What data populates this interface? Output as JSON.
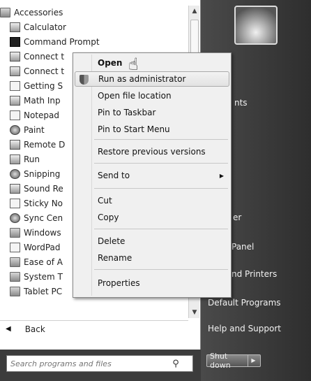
{
  "programs": [
    {
      "label": "Accessories",
      "icon": "folder-icon"
    },
    {
      "label": "Calculator",
      "icon": "calculator-icon"
    },
    {
      "label": "Command Prompt",
      "icon": "command-prompt-icon"
    },
    {
      "label": "Connect t",
      "icon": "connect-icon"
    },
    {
      "label": "Connect t",
      "icon": "connect-projector-icon"
    },
    {
      "label": "Getting S",
      "icon": "getting-started-icon"
    },
    {
      "label": "Math Inp",
      "icon": "math-input-icon"
    },
    {
      "label": "Notepad",
      "icon": "notepad-icon"
    },
    {
      "label": "Paint",
      "icon": "paint-icon"
    },
    {
      "label": "Remote D",
      "icon": "remote-desktop-icon"
    },
    {
      "label": "Run",
      "icon": "run-icon"
    },
    {
      "label": "Snipping",
      "icon": "snipping-tool-icon"
    },
    {
      "label": "Sound Re",
      "icon": "sound-recorder-icon"
    },
    {
      "label": "Sticky No",
      "icon": "sticky-notes-icon"
    },
    {
      "label": "Sync Cen",
      "icon": "sync-center-icon"
    },
    {
      "label": "Windows",
      "icon": "windows-explorer-icon"
    },
    {
      "label": "WordPad",
      "icon": "wordpad-icon"
    },
    {
      "label": "Ease of A",
      "icon": "folder-icon"
    },
    {
      "label": "System T",
      "icon": "folder-icon"
    },
    {
      "label": "Tablet PC",
      "icon": "folder-icon"
    }
  ],
  "back_label": "Back",
  "search": {
    "placeholder": "Search programs and files"
  },
  "context_menu": {
    "items": [
      {
        "label": "Open"
      },
      {
        "label": "Run as administrator"
      },
      {
        "label": "Open file location"
      },
      {
        "label": "Pin to Taskbar"
      },
      {
        "label": "Pin to Start Menu"
      },
      {
        "label": "Restore previous versions"
      },
      {
        "label": "Send to"
      },
      {
        "label": "Cut"
      },
      {
        "label": "Copy"
      },
      {
        "label": "Delete"
      },
      {
        "label": "Rename"
      },
      {
        "label": "Properties"
      }
    ]
  },
  "right_panel": {
    "partial_labels": [
      "nts",
      "er",
      "Panel",
      "nd Printers"
    ],
    "default_programs": "Default Programs",
    "help_support": "Help and Support",
    "shutdown_label": "Shut down"
  },
  "colors": {
    "menu_bg": "#f0f0f0",
    "right_panel_bg": "#3c3c3c",
    "highlight_border": "#aaaaaa"
  }
}
